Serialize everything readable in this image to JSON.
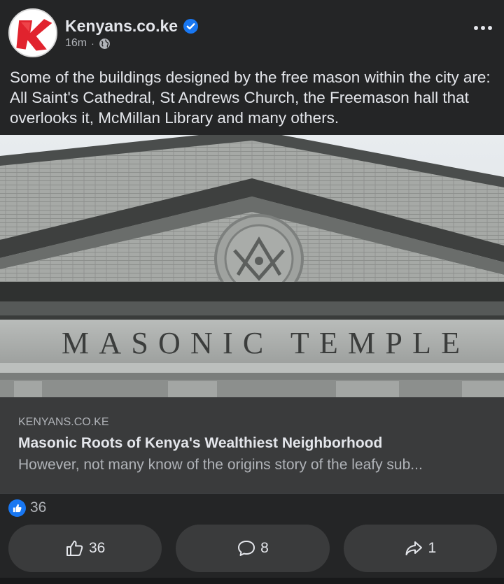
{
  "post": {
    "page_name": "Kenyans.co.ke",
    "time": "16m",
    "separator": "·",
    "caption": "Some of the buildings designed by the free mason within the city are: All Saint's Cathedral, St Andrews Church, the Freemason hall that overlooks it, McMillan Library and many others."
  },
  "photo": {
    "inscription": "MASONIC TEMPLE"
  },
  "link": {
    "domain": "KENYANS.CO.KE",
    "title": "Masonic Roots of Kenya's Wealthiest Neighborhood",
    "description": "However, not many know of the origins story of the leafy sub..."
  },
  "reactions": {
    "count": "36"
  },
  "actions": {
    "like_count": "36",
    "comment_count": "8",
    "share_count": "1"
  },
  "icons": {
    "verified": "verified-badge-icon",
    "globe": "globe-icon",
    "more": "more-options-icon",
    "like": "thumbs-up-icon",
    "comment": "comment-icon",
    "share": "share-icon"
  },
  "colors": {
    "background": "#242526",
    "card": "#3a3b3c",
    "accent": "#1877f2",
    "brand_red": "#e1232e"
  }
}
